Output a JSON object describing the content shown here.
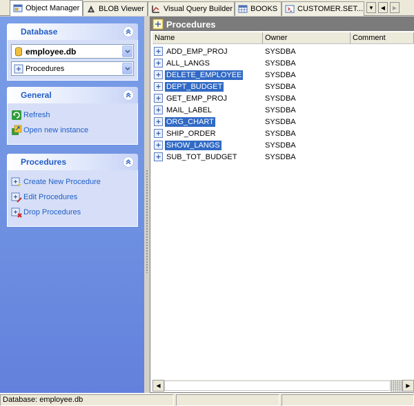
{
  "tabs": [
    {
      "label": "Object Manager",
      "icon": "object-manager-icon",
      "active": true
    },
    {
      "label": "BLOB Viewer",
      "icon": "blob-viewer-icon"
    },
    {
      "label": "Visual Query Builder",
      "icon": "query-builder-icon"
    },
    {
      "label": "BOOKS",
      "icon": "table-icon"
    },
    {
      "label": "CUSTOMER.SET...",
      "icon": "procedure-tab-icon"
    }
  ],
  "tab_nav": {
    "dropdown": "▼",
    "prev": "◀",
    "next": "▶"
  },
  "database_panel": {
    "title": "Database",
    "database_value": "employee.db",
    "object_type_value": "Procedures"
  },
  "general_panel": {
    "title": "General",
    "links": [
      {
        "label": "Refresh",
        "icon": "refresh-icon"
      },
      {
        "label": "Open new instance",
        "icon": "open-instance-icon"
      }
    ]
  },
  "procedures_panel": {
    "title": "Procedures",
    "links": [
      {
        "label": "Create New Procedure",
        "icon": "create-procedure-icon"
      },
      {
        "label": "Edit Procedures",
        "icon": "edit-procedure-icon"
      },
      {
        "label": "Drop Procedures",
        "icon": "drop-procedure-icon"
      }
    ]
  },
  "list": {
    "title": "Procedures",
    "columns": [
      "Name",
      "Owner",
      "Comment"
    ],
    "rows": [
      {
        "name": "ADD_EMP_PROJ",
        "owner": "SYSDBA",
        "selected": false
      },
      {
        "name": "ALL_LANGS",
        "owner": "SYSDBA",
        "selected": false
      },
      {
        "name": "DELETE_EMPLOYEE",
        "owner": "SYSDBA",
        "selected": true
      },
      {
        "name": "DEPT_BUDGET",
        "owner": "SYSDBA",
        "selected": true
      },
      {
        "name": "GET_EMP_PROJ",
        "owner": "SYSDBA",
        "selected": false
      },
      {
        "name": "MAIL_LABEL",
        "owner": "SYSDBA",
        "selected": false
      },
      {
        "name": "ORG_CHART",
        "owner": "SYSDBA",
        "selected": true
      },
      {
        "name": "SHIP_ORDER",
        "owner": "SYSDBA",
        "selected": false
      },
      {
        "name": "SHOW_LANGS",
        "owner": "SYSDBA",
        "selected": true
      },
      {
        "name": "SUB_TOT_BUDGET",
        "owner": "SYSDBA",
        "selected": false
      }
    ]
  },
  "scrollbar": {
    "left": "◀",
    "right": "▶"
  },
  "status": {
    "database": "Database: employee.db"
  },
  "colors": {
    "selection": "#316ac5",
    "panel_title": "#215dc6",
    "header_gray": "#7b7b7b"
  }
}
